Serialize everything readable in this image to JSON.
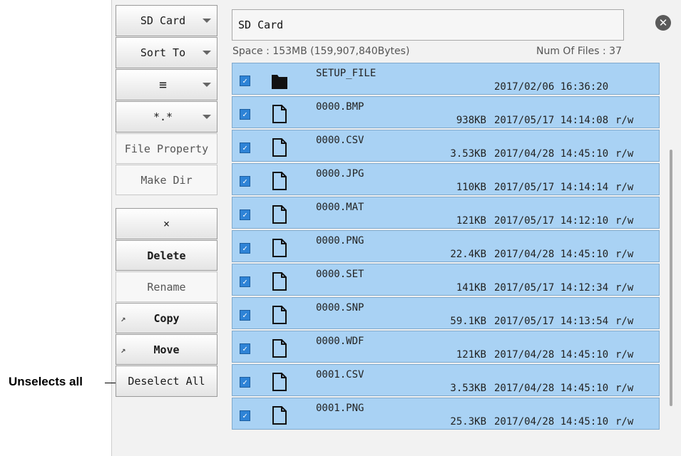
{
  "callout": {
    "text": "Unselects all"
  },
  "menu": {
    "drive": "SD Card",
    "sort": "Sort To",
    "view_icon": "list-icon",
    "filter": "*.*",
    "file_property": "File Property",
    "make_dir": "Make Dir",
    "clear": "×",
    "delete": "Delete",
    "rename": "Rename",
    "copy": "Copy",
    "move": "Move",
    "deselect_all": "Deselect All"
  },
  "header": {
    "path": "SD Card",
    "space": "Space : 153MB (159,907,840Bytes)",
    "num_files": "Num Of Files : 37"
  },
  "files": [
    {
      "name": "SETUP_FILE",
      "size": "",
      "date": "2017/02/06 16:36:20",
      "attr": "",
      "type": "folder",
      "checked": true
    },
    {
      "name": "0000.BMP",
      "size": "938KB",
      "date": "2017/05/17 14:14:08",
      "attr": "r/w",
      "type": "file",
      "checked": true
    },
    {
      "name": "0000.CSV",
      "size": "3.53KB",
      "date": "2017/04/28 14:45:10",
      "attr": "r/w",
      "type": "file",
      "checked": true
    },
    {
      "name": "0000.JPG",
      "size": "110KB",
      "date": "2017/05/17 14:14:14",
      "attr": "r/w",
      "type": "file",
      "checked": true
    },
    {
      "name": "0000.MAT",
      "size": "121KB",
      "date": "2017/05/17 14:12:10",
      "attr": "r/w",
      "type": "file",
      "checked": true
    },
    {
      "name": "0000.PNG",
      "size": "22.4KB",
      "date": "2017/04/28 14:45:10",
      "attr": "r/w",
      "type": "file",
      "checked": true
    },
    {
      "name": "0000.SET",
      "size": "141KB",
      "date": "2017/05/17 14:12:34",
      "attr": "r/w",
      "type": "file",
      "checked": true
    },
    {
      "name": "0000.SNP",
      "size": "59.1KB",
      "date": "2017/05/17 14:13:54",
      "attr": "r/w",
      "type": "file",
      "checked": true
    },
    {
      "name": "0000.WDF",
      "size": "121KB",
      "date": "2017/04/28 14:45:10",
      "attr": "r/w",
      "type": "file",
      "checked": true
    },
    {
      "name": "0001.CSV",
      "size": "3.53KB",
      "date": "2017/04/28 14:45:10",
      "attr": "r/w",
      "type": "file",
      "checked": true
    },
    {
      "name": "0001.PNG",
      "size": "25.3KB",
      "date": "2017/04/28 14:45:10",
      "attr": "r/w",
      "type": "file",
      "checked": true
    }
  ],
  "colors": {
    "row_bg": "#a9d2f4",
    "checkbox": "#2e83d6",
    "panel_bg": "#f2f2f2"
  }
}
